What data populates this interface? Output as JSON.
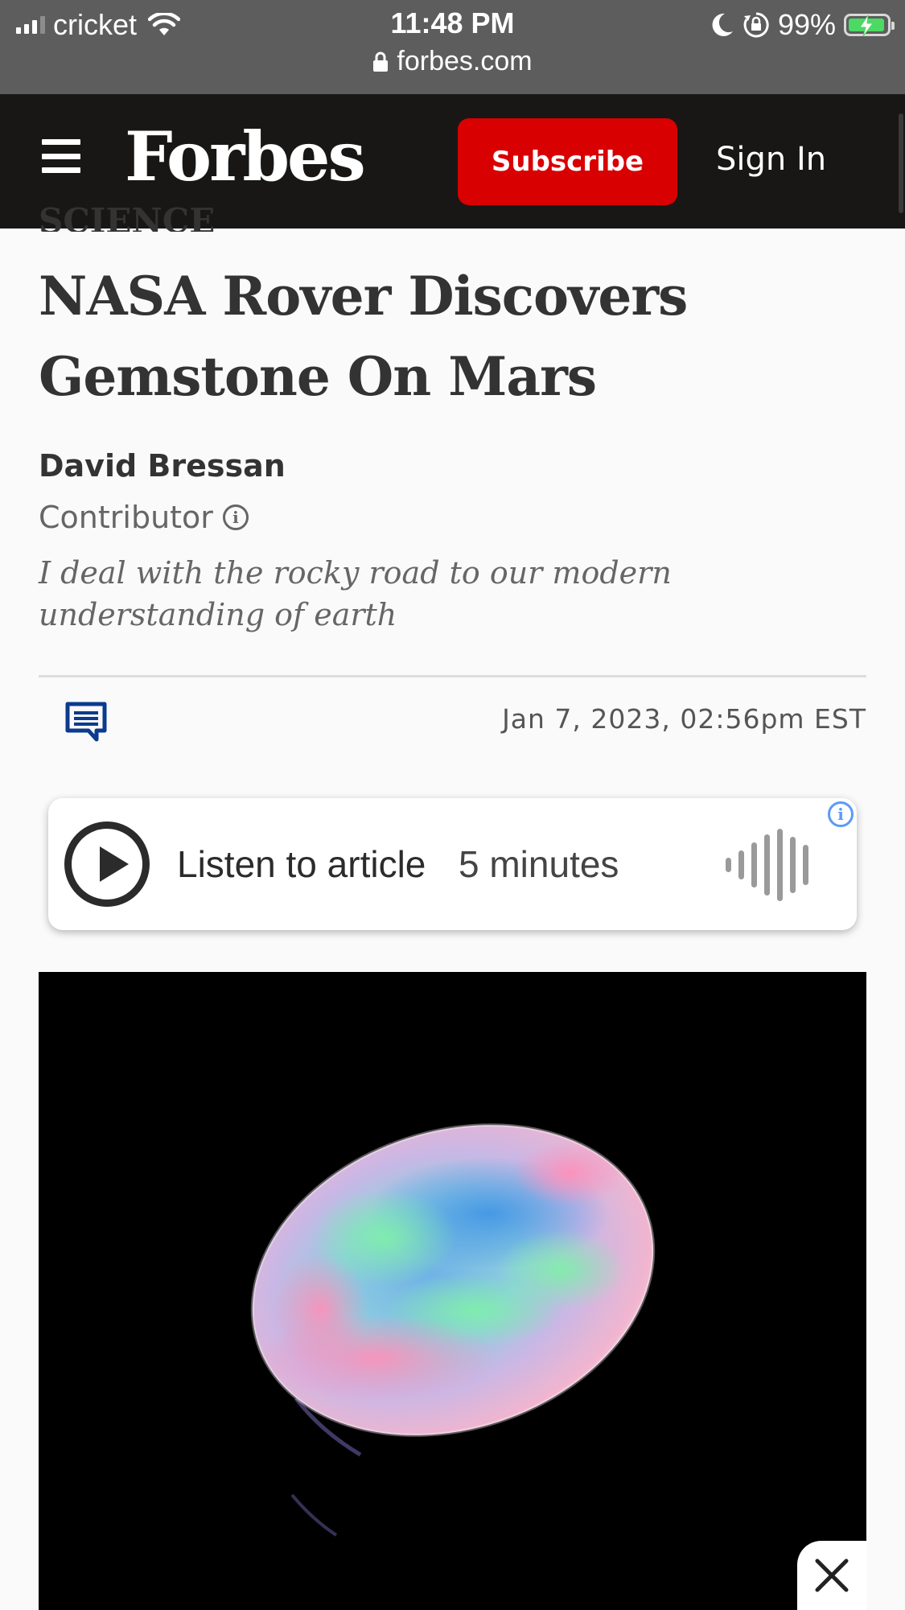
{
  "status_bar": {
    "carrier": "cricket",
    "time": "11:48 PM",
    "battery": "99%",
    "url": "forbes.com"
  },
  "header": {
    "logo": "Forbes",
    "subscribe_label": "Subscribe",
    "signin_label": "Sign In"
  },
  "article": {
    "section": "SCIENCE",
    "title": "NASA Rover Discovers Gemstone On Mars",
    "author": "David Bressan",
    "role": "Contributor",
    "bio": "I deal with the rocky road to our modern understanding of earth",
    "date": "Jan 7, 2023, 02:56pm EST"
  },
  "listen": {
    "label": "Listen to article",
    "duration": "5 minutes"
  },
  "colors": {
    "header_bg": "#181716",
    "subscribe_bg": "#d80000",
    "comment_icon": "#0c3a8f",
    "info_blue": "#5b9bf5"
  },
  "icons": {
    "menu": "hamburger-icon",
    "comment": "comment-icon",
    "play": "play-icon",
    "close": "close-icon"
  }
}
